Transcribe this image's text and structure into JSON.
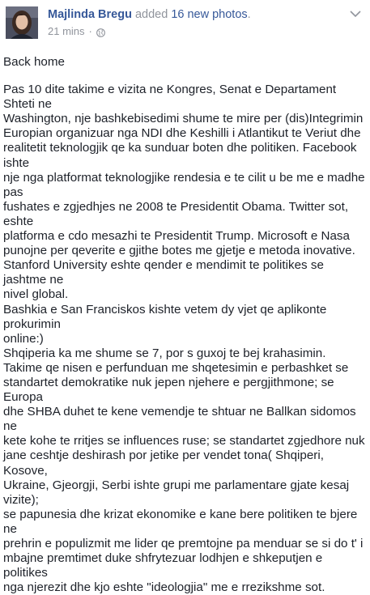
{
  "post": {
    "author": "Majlinda Bregu",
    "action_prefix": "added",
    "action_link": "16 new photos",
    "action_suffix": ".",
    "timestamp": "21 mins",
    "separator": "·",
    "privacy_icon": "globe-icon",
    "menu_icon": "chevron-down-icon",
    "text": {
      "heading": "Back home",
      "lines": [
        "Pas 10 dite takime e vizita ne Kongres, Senat e Departament Shteti ne",
        "Washington, nje bashkebisedimi shume te mire per (dis)Integrimin",
        "Europian organizuar nga NDI dhe Keshilli i Atlantikut te Veriut dhe",
        "realitetit teknologjik qe ka sunduar boten dhe politiken. Facebook ishte",
        "nje nga platformat teknologjike rendesia e te cilit u be me e madhe pas",
        "fushates e zgjedhjes ne 2008 te Presidentit Obama. Twitter sot, eshte",
        "platforma e cdo mesazhi te Presidentit Trump. Microsoft e Nasa",
        "punojne per qeverite e gjithe botes me gjetje e metoda inovative.",
        "Stanford University eshte qender e mendimit te politikes se jashtme ne",
        "nivel global.",
        "Bashkia e San Franciskos kishte vetem dy vjet qe aplikonte prokurimin",
        "online:)",
        "Shqiperia ka me shume se 7, por s guxoj te bej krahasimin.",
        "Takime qe nisen e perfunduan me shqetesimin e perbashket se",
        "standartet demokratike nuk jepen njehere e pergjithmone; se Europa",
        "dhe SHBA duhet te kene vemendje te shtuar ne Ballkan sidomos ne",
        "kete kohe te rritjes se influences ruse; se standartet zgjedhore nuk",
        "jane ceshtje deshirash por jetike per vendet tona( Shqiperi, Kosove,",
        "Ukraine, Gjeorgji, Serbi ishte grupi me parlamentare gjate kesaj vizite);",
        "se papunesia dhe krizat ekonomike e kane bere politiken te bjere ne",
        "prehrin e populizmit me lider qe premtojne pa menduar se si do t' i",
        "mbajne premtimet duke shfrytezuar lodhjen e shkeputjen e politikes",
        "nga njerezit dhe kjo eshte \"ideologjia\" me e rrezikshme sot."
      ]
    }
  },
  "colors": {
    "link": "#365899",
    "meta": "#90949c",
    "text": "#1d2129"
  }
}
